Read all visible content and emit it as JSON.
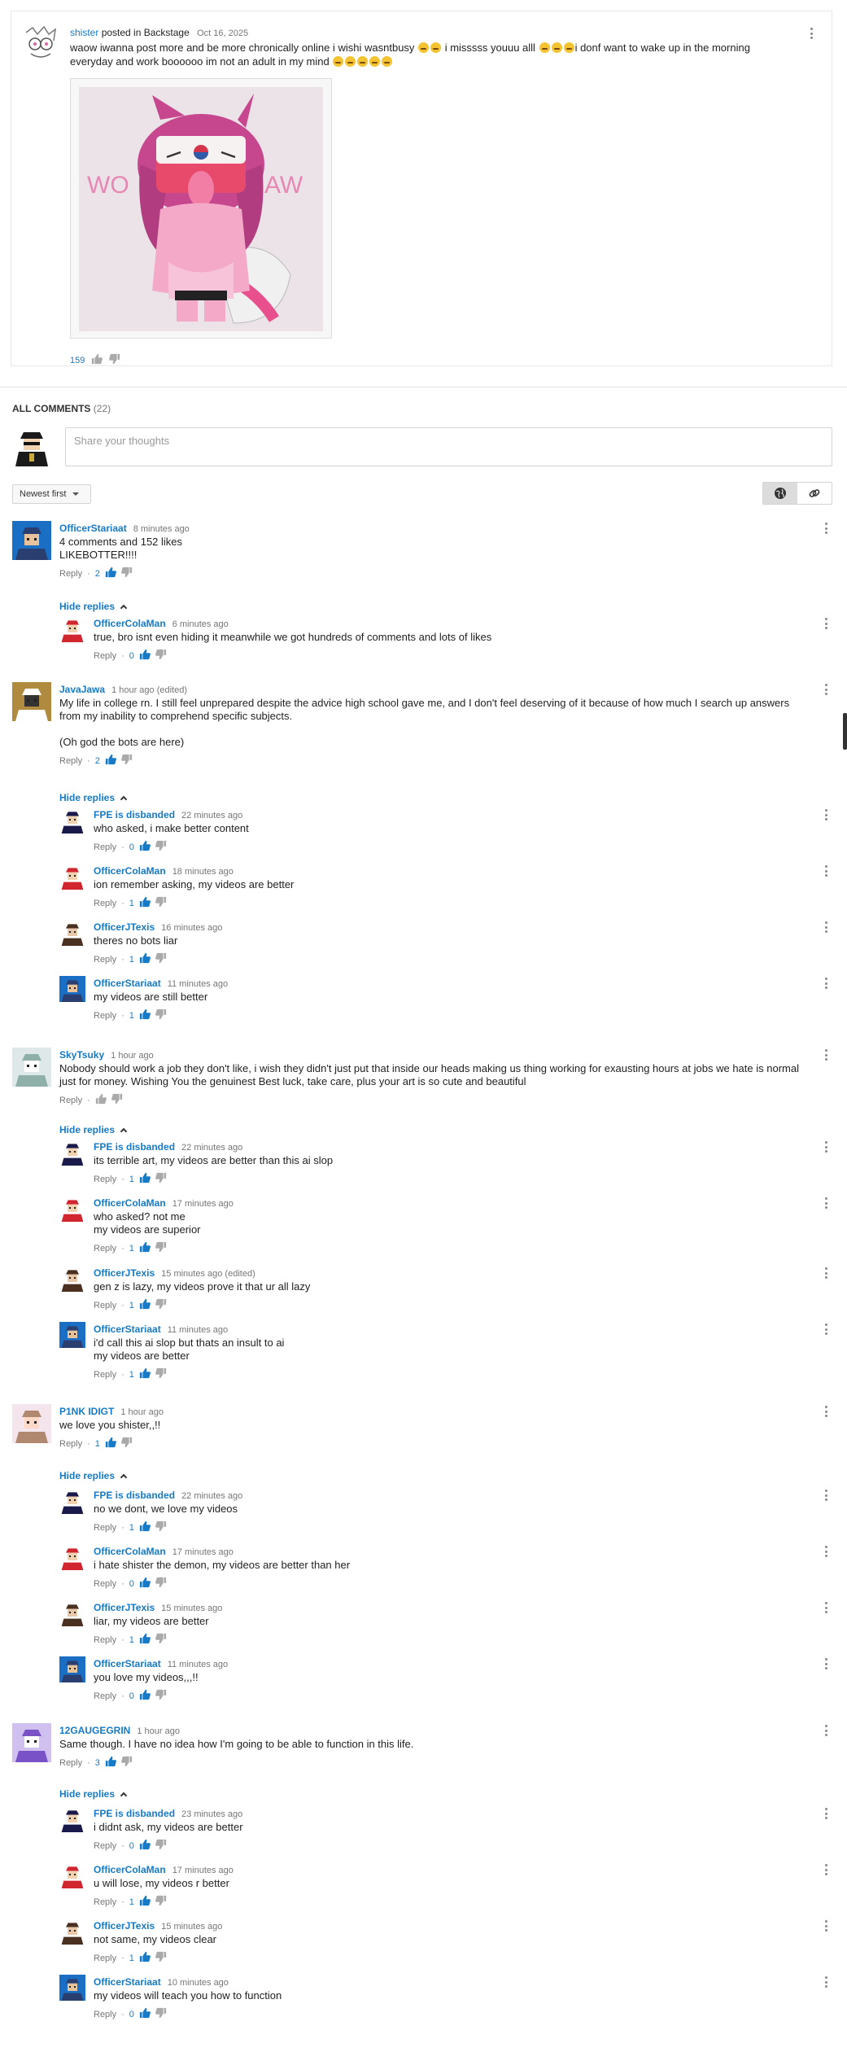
{
  "post": {
    "author": "shister",
    "posted_in": "posted in Backstage",
    "date": "Oct 16, 2025",
    "text_part1": "waow iwanna post more and be more chronically online i wishi wasntbusy",
    "text_part2": "i misssss youuu alll",
    "text_part3": "i donf want to wake up in the morning everyday and work boooooo im not an adult in my mind",
    "image_text_left": "WO",
    "image_text_right": "AW",
    "like_count": "159"
  },
  "section": {
    "title": "ALL COMMENTS",
    "count": "(22)"
  },
  "comment_box": {
    "placeholder": "Share your thoughts"
  },
  "sort": {
    "label": "Newest first"
  },
  "actions": {
    "reply": "Reply",
    "hide_replies": "Hide replies"
  },
  "colors": {
    "link": "#167ac6",
    "text": "#222222",
    "muted": "#767676",
    "like_blue": "#167ac6"
  },
  "comments": [
    {
      "author": "OfficerStariaat",
      "time": "8 minutes ago",
      "text": "4 comments and 152 likes\nLIKEBOTTER!!!!",
      "likes": "2",
      "replies": [
        {
          "author": "OfficerColaMan",
          "time": "6 minutes ago",
          "text": "true, bro isnt even hiding it meanwhile we got hundreds of comments and lots of likes",
          "likes": "0"
        }
      ]
    },
    {
      "author": "JavaJawa",
      "time": "1 hour ago (edited)",
      "text": "My life in college rn. I still feel unprepared despite the advice high school gave me, and I don't feel deserving of it because of how much I search up answers from my inability to comprehend specific subjects.\n\n(Oh god the bots are here)",
      "likes": "2",
      "replies": [
        {
          "author": "FPE is disbanded",
          "time": "22 minutes ago",
          "text": "who asked, i make better content",
          "likes": "0"
        },
        {
          "author": "OfficerColaMan",
          "time": "18 minutes ago",
          "text": "ion remember asking, my videos are better",
          "likes": "1"
        },
        {
          "author": "OfficerJTexis",
          "time": "16 minutes ago",
          "text": "theres no bots liar",
          "likes": "1"
        },
        {
          "author": "OfficerStariaat",
          "time": "11 minutes ago",
          "text": "my videos are still better",
          "likes": "1"
        }
      ]
    },
    {
      "author": "SkyTsuky",
      "time": "1 hour ago",
      "text": "Nobody should work a job they don't like, i wish they didn't just put that inside our heads making us thing working for exausting hours at jobs we hate is normal just for money. Wishing You the genuinest Best luck, take care, plus your art is so cute and beautiful",
      "likes": "",
      "replies": [
        {
          "author": "FPE is disbanded",
          "time": "22 minutes ago",
          "text": "its terrible art, my videos are better than this ai slop",
          "likes": "1"
        },
        {
          "author": "OfficerColaMan",
          "time": "17 minutes ago",
          "text": "who asked? not me\nmy videos are superior",
          "likes": "1"
        },
        {
          "author": "OfficerJTexis",
          "time": "15 minutes ago (edited)",
          "text": "gen z is lazy, my videos prove it that ur all lazy",
          "likes": "1"
        },
        {
          "author": "OfficerStariaat",
          "time": "11 minutes ago",
          "text": "i'd call this ai slop but thats an insult to ai\nmy videos are better",
          "likes": "1"
        }
      ]
    },
    {
      "author": "P1NK IDIGT",
      "time": "1 hour ago",
      "text": "we love you shister,,!!",
      "likes": "1",
      "replies": [
        {
          "author": "FPE is disbanded",
          "time": "22 minutes ago",
          "text": "no we dont, we love my videos",
          "likes": "1"
        },
        {
          "author": "OfficerColaMan",
          "time": "17 minutes ago",
          "text": "i hate shister the demon, my videos are better than her",
          "likes": "0"
        },
        {
          "author": "OfficerJTexis",
          "time": "15 minutes ago",
          "text": "liar, my videos are better",
          "likes": "1"
        },
        {
          "author": "OfficerStariaat",
          "time": "11 minutes ago",
          "text": "you love my videos,,,!!",
          "likes": "0"
        }
      ]
    },
    {
      "author": "12GAUGEGRIN",
      "time": "1 hour ago",
      "text": "Same though. I have no idea how I'm going to be able to function in this life.",
      "likes": "3",
      "replies": [
        {
          "author": "FPE is disbanded",
          "time": "23 minutes ago",
          "text": "i didnt ask, my videos are better",
          "likes": "0"
        },
        {
          "author": "OfficerColaMan",
          "time": "17 minutes ago",
          "text": "u will lose, my videos r better",
          "likes": "1"
        },
        {
          "author": "OfficerJTexis",
          "time": "15 minutes ago",
          "text": "not same, my videos clear",
          "likes": "1"
        },
        {
          "author": "OfficerStariaat",
          "time": "10 minutes ago",
          "text": "my videos will teach you how to function",
          "likes": "0"
        }
      ]
    }
  ]
}
